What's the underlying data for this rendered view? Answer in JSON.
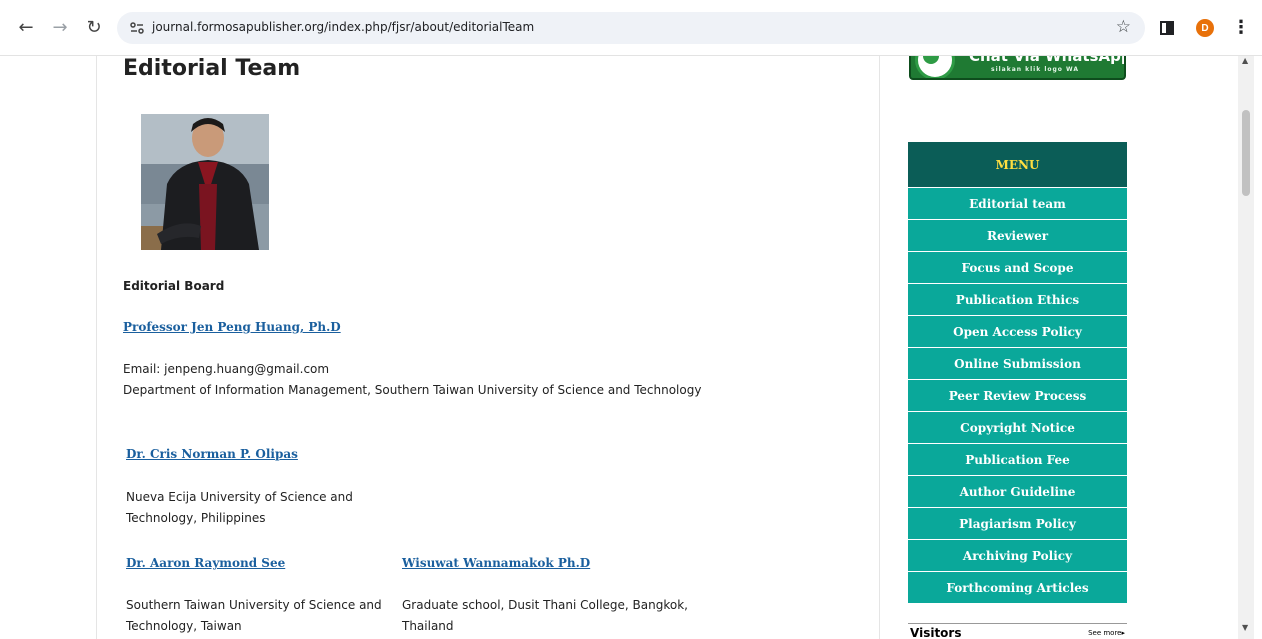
{
  "browser": {
    "url": "journal.formosapublisher.org/index.php/fjsr/about/editorialTeam",
    "avatar_initial": "D",
    "back_icon": "arrow-left-icon",
    "forward_icon": "arrow-right-icon",
    "reload_icon": "reload-icon",
    "bookmark_icon": "star-icon"
  },
  "page": {
    "title": "Editorial Team",
    "board_heading": "Editorial Board",
    "people": [
      {
        "name": "Professor Jen Peng Huang, Ph.D ",
        "lines": [
          "Email: jenpeng.huang@gmail.com",
          "Department of Information Management, Southern Taiwan University of Science and Technology"
        ]
      },
      {
        "name": "Dr. Cris Norman P. Olipas",
        "lines": [
          "Nueva Ecija University of Science and",
          "Technology, Philippines"
        ]
      },
      {
        "name": "Dr. Aaron Raymond See",
        "lines": [
          "Southern Taiwan University of Science and",
          "Technology, Taiwan"
        ]
      },
      {
        "name": "Wisuwat Wannamakok Ph.D",
        "lines": [
          "Graduate school, Dusit Thani College, Bangkok,",
          "Thailand"
        ]
      }
    ]
  },
  "sidebar": {
    "whatsapp": {
      "title": "Chat Via WhatsApp",
      "subtitle": "silakan klik logo WA"
    },
    "menu_title": "MENU",
    "menu_items": [
      "Editorial team",
      "Reviewer",
      "Focus and Scope",
      "Publication Ethics",
      "Open Access Policy",
      "Online Submission",
      "Peer Review Process",
      "Copyright Notice",
      "Publication Fee",
      "Author Guideline",
      "Plagiarism Policy",
      "Archiving Policy",
      "Forthcoming Articles"
    ],
    "visitors_label": "Visitors",
    "visitors_more": "See more▸"
  },
  "colors": {
    "menu_header_bg": "#0b5d57",
    "menu_header_text": "#ffde40",
    "menu_item_bg": "#0aa89a",
    "link": "#1a5f9e",
    "whatsapp_green": "#1f7a33"
  }
}
